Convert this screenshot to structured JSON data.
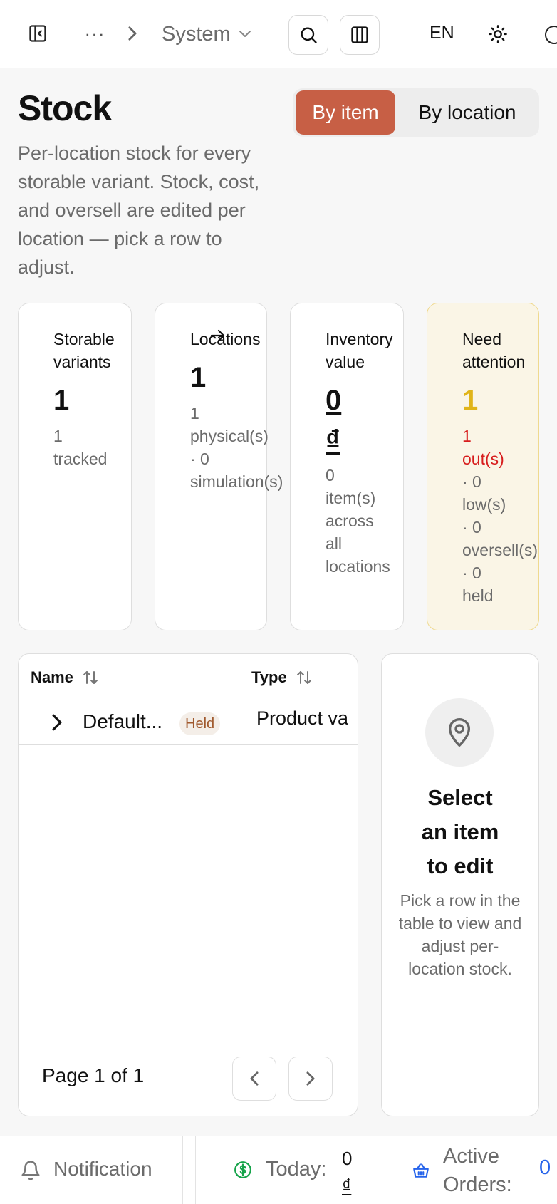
{
  "topbar": {
    "breadcrumb_more": "···",
    "breadcrumb_current": "System",
    "language": "EN"
  },
  "page": {
    "title": "Stock",
    "subtitle": "Per-location stock for every storable variant. Stock, cost, and oversell are edited per location — pick a row to adjust.",
    "view_toggle": {
      "by_item": "By item",
      "by_location": "By location",
      "selected": "By item"
    }
  },
  "stats": {
    "variants": {
      "label_line1": "Storable",
      "label_line2": "variants",
      "value": "1",
      "sub_line1": "1",
      "sub_line2": "tracked"
    },
    "locations": {
      "label": "Locations",
      "value": "1",
      "sub_line1": "1",
      "sub_line2": "physical(s)",
      "sub_line3": "· 0",
      "sub_line4": "simulation(s)"
    },
    "inventory": {
      "label_line1": "Inventory",
      "label_line2": "value",
      "value": "0",
      "currency": "₫",
      "sub_line1": "0",
      "sub_line2": "item(s)",
      "sub_line3": "across",
      "sub_line4": "all",
      "sub_line5": "locations"
    },
    "attention": {
      "label_line1": "Need",
      "label_line2": "attention",
      "value": "1",
      "out_line1": "1",
      "out_line2": "out(s)",
      "sub_line1": "· 0",
      "sub_line2": "low(s)",
      "sub_line3": "· 0",
      "sub_line4": "oversell(s)",
      "sub_line5": "· 0",
      "sub_line6": "held"
    }
  },
  "table": {
    "columns": {
      "name": "Name",
      "type": "Type"
    },
    "rows": [
      {
        "name": "Default...",
        "badge": "Held",
        "type": "Product va"
      }
    ],
    "pagination": "Page 1 of 1"
  },
  "edit_panel": {
    "title_line1": "Select",
    "title_line2": "an item",
    "title_line3": "to edit",
    "desc": "Pick a row in the table to view and adjust per-location stock."
  },
  "footer": {
    "notification": "Notification",
    "today_label": "Today:",
    "today_value": "0",
    "today_currency": "₫",
    "orders_line1": "Active",
    "orders_line2": "Orders:",
    "orders_value": "0"
  },
  "colors": {
    "accent": "#c75f45",
    "warning": "#e0b419",
    "danger": "#d71d1d",
    "link": "#2563eb",
    "success": "#16a34a"
  }
}
